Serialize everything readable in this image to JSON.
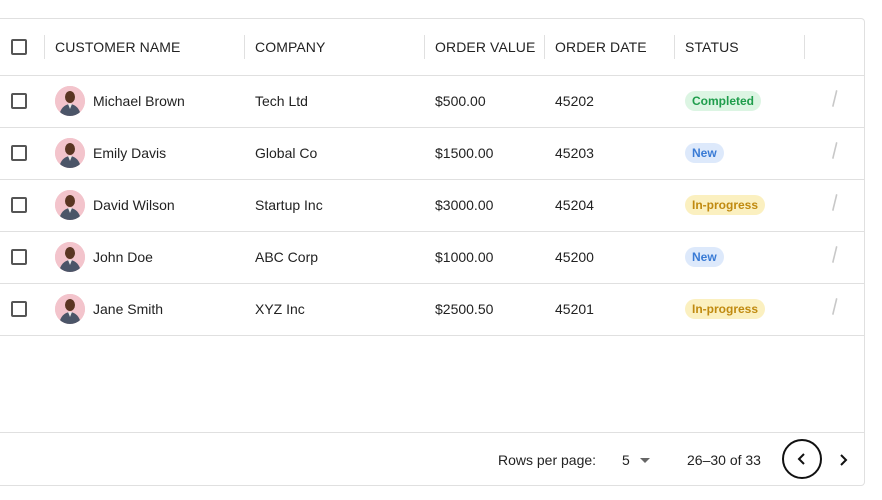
{
  "columns": {
    "customer_name": "CUSTOMER NAME",
    "company": "COMPANY",
    "order_value": "ORDER VALUE",
    "order_date": "ORDER DATE",
    "status": "STATUS"
  },
  "rows": [
    {
      "name": "Michael Brown",
      "company": "Tech Ltd",
      "value": "$500.00",
      "date": "45202",
      "status": "Completed"
    },
    {
      "name": "Emily Davis",
      "company": "Global Co",
      "value": "$1500.00",
      "date": "45203",
      "status": "New"
    },
    {
      "name": "David Wilson",
      "company": "Startup Inc",
      "value": "$3000.00",
      "date": "45204",
      "status": "In-progress"
    },
    {
      "name": "John Doe",
      "company": "ABC Corp",
      "value": "$1000.00",
      "date": "45200",
      "status": "New"
    },
    {
      "name": "Jane Smith",
      "company": "XYZ Inc",
      "value": "$2500.50",
      "date": "45201",
      "status": "In-progress"
    }
  ],
  "pagination": {
    "rows_per_page_label": "Rows per page:",
    "rows_per_page_value": "5",
    "range_text": "26–30 of 33"
  },
  "colors": {
    "completed": "#1f9d4c",
    "new": "#3a7bd5",
    "in_progress": "#c08a10"
  }
}
